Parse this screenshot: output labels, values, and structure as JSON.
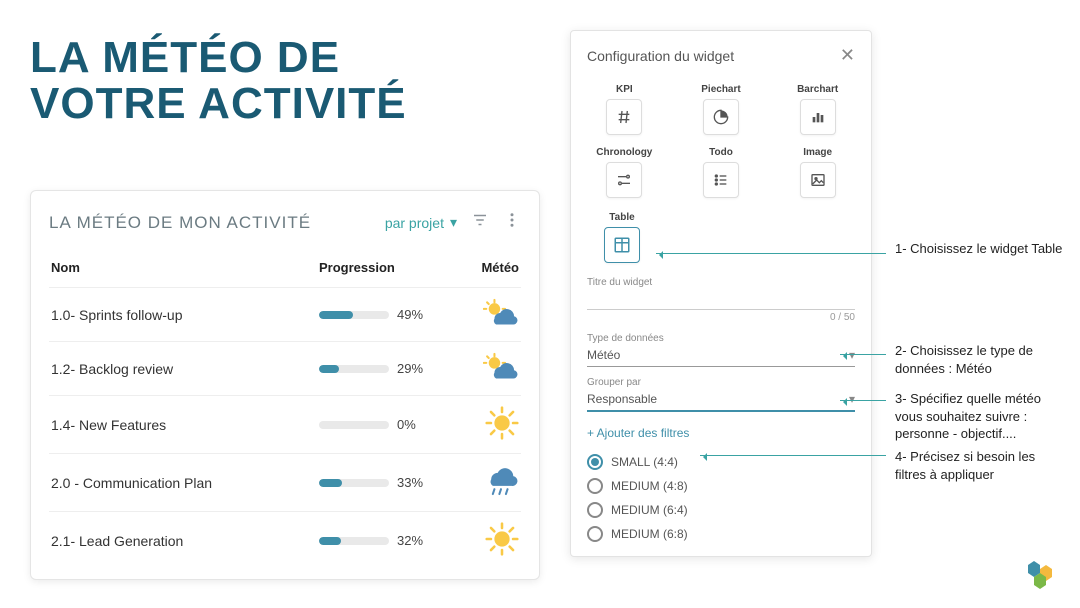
{
  "title_line1": "LA MÉTÉO DE",
  "title_line2": "VOTRE ACTIVITÉ",
  "card": {
    "title": "LA MÉTÉO DE MON ACTIVITÉ",
    "toggle": "par projet",
    "head_nom": "Nom",
    "head_prog": "Progression",
    "head_meteo": "Météo",
    "rows": [
      {
        "name": "1.0- Sprints follow-up",
        "progress": 49,
        "weather": "sun-cloud"
      },
      {
        "name": "1.2- Backlog review",
        "progress": 29,
        "weather": "sun-cloud"
      },
      {
        "name": "1.4- New Features",
        "progress": 0,
        "weather": "sun"
      },
      {
        "name": "2.0 - Communication Plan",
        "progress": 33,
        "weather": "rain"
      },
      {
        "name": "2.1- Lead Generation",
        "progress": 32,
        "weather": "sun"
      }
    ]
  },
  "panel": {
    "title": "Configuration du widget",
    "tiles": [
      {
        "label": "KPI",
        "icon": "hash"
      },
      {
        "label": "Piechart",
        "icon": "pie"
      },
      {
        "label": "Barchart",
        "icon": "bar"
      },
      {
        "label": "Chronology",
        "icon": "timeline"
      },
      {
        "label": "Todo",
        "icon": "list"
      },
      {
        "label": "Image",
        "icon": "image"
      }
    ],
    "tile_table": {
      "label": "Table",
      "icon": "table",
      "selected": true
    },
    "field_title_label": "Titre du widget",
    "counter": "0 / 50",
    "field_type_label": "Type de données",
    "field_type_value": "Météo",
    "field_group_label": "Grouper par",
    "field_group_value": "Responsable",
    "add_filter": "+ Ajouter des filtres",
    "radios": [
      {
        "label": "SMALL (4:4)",
        "checked": true
      },
      {
        "label": "MEDIUM (4:8)",
        "checked": false
      },
      {
        "label": "MEDIUM (6:4)",
        "checked": false
      },
      {
        "label": "MEDIUM (6:8)",
        "checked": false
      }
    ]
  },
  "annotations": {
    "a1": "1- Choisissez le widget Table",
    "a2": "2- Choisissez le type de données : Météo",
    "a3": "3- Spécifiez quelle météo vous souhaitez suivre : personne - objectif....",
    "a4": "4- Précisez si besoin les filtres à appliquer"
  }
}
